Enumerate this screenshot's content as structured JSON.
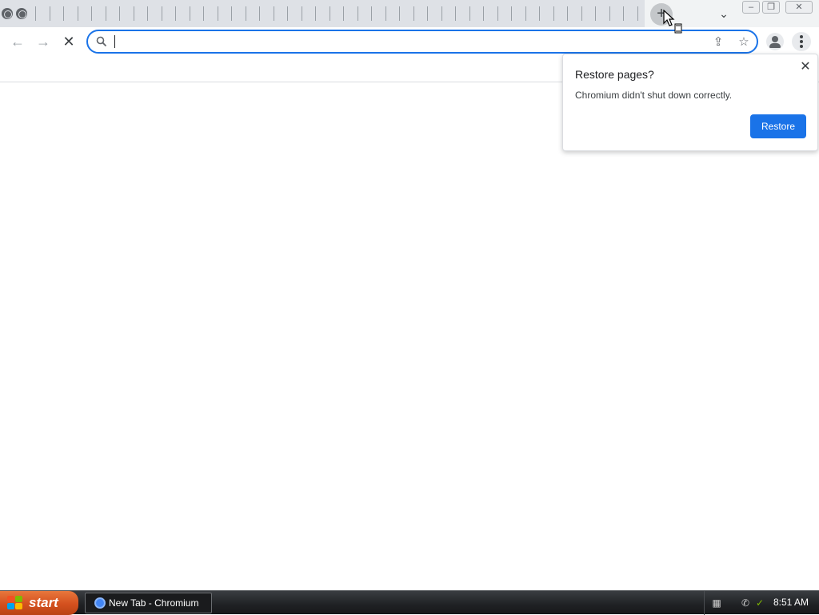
{
  "window": {
    "tab_count_visible": 44,
    "new_tab_symbol": "+",
    "tab_search_symbol": "⌄",
    "minimize_symbol": "–",
    "restore_symbol": "❐",
    "close_symbol": "✕"
  },
  "toolbar": {
    "back_symbol": "←",
    "forward_symbol": "→",
    "stop_symbol": "✕",
    "omnibox_value": "",
    "share_symbol": "⇪",
    "bookmark_symbol": "☆"
  },
  "restore_bubble": {
    "title": "Restore pages?",
    "message": "Chromium didn't shut down correctly.",
    "button_label": "Restore",
    "close_symbol": "✕",
    "button_color": "#1a73e8"
  },
  "taskbar": {
    "start_label": "start",
    "task_label": "New Tab - Chromium",
    "clock": "8:51 AM"
  },
  "colors": {
    "accent": "#1a73e8",
    "taskbar": "#1f2124",
    "start": "#d4501e"
  }
}
